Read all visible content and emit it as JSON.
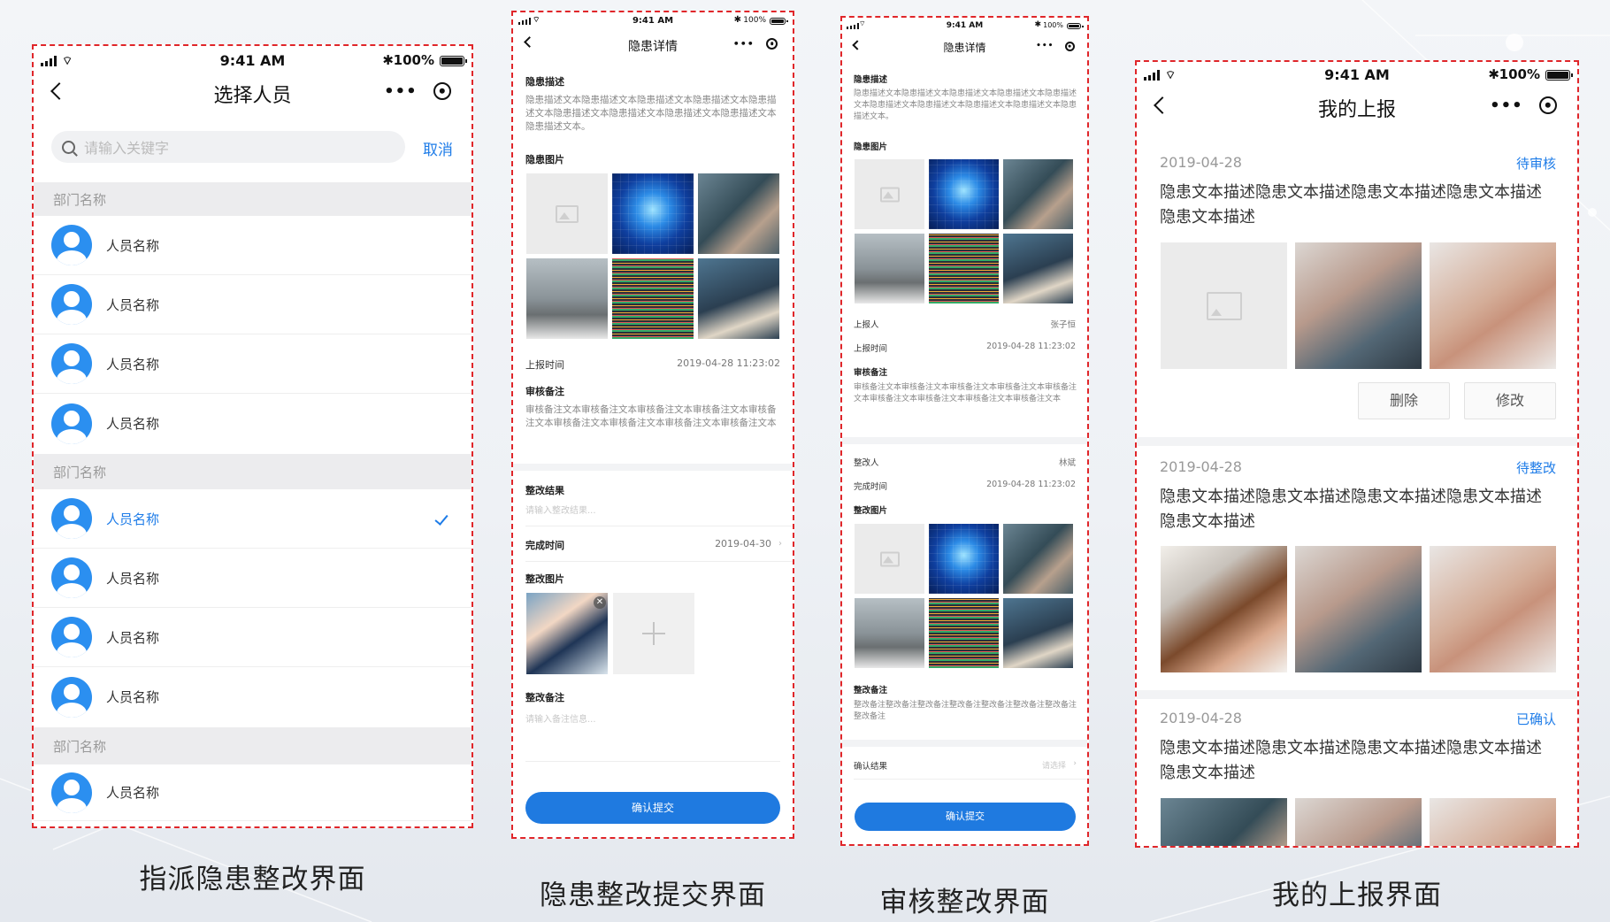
{
  "colors": {
    "accent": "#1e7ce8",
    "frame_border": "#e0262a",
    "primary_button": "#1f7ae0",
    "section_bg": "#ececee"
  },
  "status": {
    "time": "9:41 AM",
    "battery": "100%"
  },
  "icons": [
    "signal-icon",
    "wifi-icon",
    "bluetooth-icon",
    "battery-icon",
    "back-icon",
    "more-icon",
    "target-icon",
    "search-icon",
    "check-icon",
    "image-placeholder-icon",
    "plus-icon",
    "close-icon",
    "chevron-right-icon"
  ],
  "captions": {
    "assign": "指派隐患整改界面",
    "submit": "隐患整改提交界面",
    "review": "审核整改界面",
    "reports": "我的上报界面"
  },
  "assign": {
    "title": "选择人员",
    "search_placeholder": "请输入关键字",
    "cancel": "取消",
    "sections": [
      {
        "dept": "部门名称",
        "people": [
          "人员名称",
          "人员名称",
          "人员名称",
          "人员名称"
        ]
      },
      {
        "dept": "部门名称",
        "people": [
          "人员名称",
          "人员名称",
          "人员名称",
          "人员名称"
        ]
      },
      {
        "dept": "部门名称",
        "people": [
          "人员名称"
        ]
      }
    ],
    "selected_person": "section 2, first person"
  },
  "submit": {
    "title": "隐患详情",
    "desc_label": "隐患描述",
    "desc_text": "隐患描述文本隐患描述文本隐患描述文本隐患描述文本隐患描述文本隐患描述文本隐患描述文本隐患描述文本隐患描述文本隐患描述文本。",
    "images_label": "隐患图片",
    "report_time_label": "上报时间",
    "report_time": "2019-04-28  11:23:02",
    "review_label": "审核备注",
    "review_text": "审核备注文本审核备注文本审核备注文本审核备注文本审核备注文本审核备注文本审核备注文本审核备注文本审核备注文本",
    "result_label": "整改结果",
    "result_placeholder": "请输入整改结果...",
    "finish_label": "完成时间",
    "finish_value": "2019-04-30",
    "fix_images_label": "整改图片",
    "fix_remark_label": "整改备注",
    "fix_remark_placeholder": "请输入备注信息...",
    "button": "确认提交"
  },
  "review": {
    "title": "隐患详情",
    "desc_label": "隐患描述",
    "desc_text": "隐患描述文本隐患描述文本隐患描述文本隐患描述文本隐患描述文本隐患描述文本隐患描述文本隐患描述文本隐患描述文本隐患描述文本。",
    "images_label": "隐患图片",
    "reporter_label": "上报人",
    "reporter": "张子恒",
    "report_time_label": "上报时间",
    "report_time": "2019-04-28  11:23:02",
    "review_label": "审核备注",
    "review_text": "审核备注文本审核备注文本审核备注文本审核备注文本审核备注文本审核备注文本审核备注文本审核备注文本审核备注文本",
    "fixer_label": "整改人",
    "fixer": "林斌",
    "finish_label": "完成时间",
    "finish_value": "2019-04-28  11:23:02",
    "fix_images_label": "整改图片",
    "fix_remark_label": "整改备注",
    "fix_remark_text": "整改备注整改备注整改备注整改备注整改备注整改备注整改备注整改备注",
    "confirm_label": "确认结果",
    "confirm_placeholder": "请选择",
    "button": "确认提交"
  },
  "reports": {
    "title": "我的上报",
    "cards": [
      {
        "date": "2019-04-28",
        "status": "待审核",
        "desc": "隐患文本描述隐患文本描述隐患文本描述隐患文本描述隐患文本描述",
        "actions": [
          "删除",
          "修改"
        ]
      },
      {
        "date": "2019-04-28",
        "status": "待整改",
        "desc": "隐患文本描述隐患文本描述隐患文本描述隐患文本描述隐患文本描述"
      },
      {
        "date": "2019-04-28",
        "status": "已确认",
        "desc": "隐患文本描述隐患文本描述隐患文本描述隐患文本描述隐患文本描述"
      }
    ]
  }
}
